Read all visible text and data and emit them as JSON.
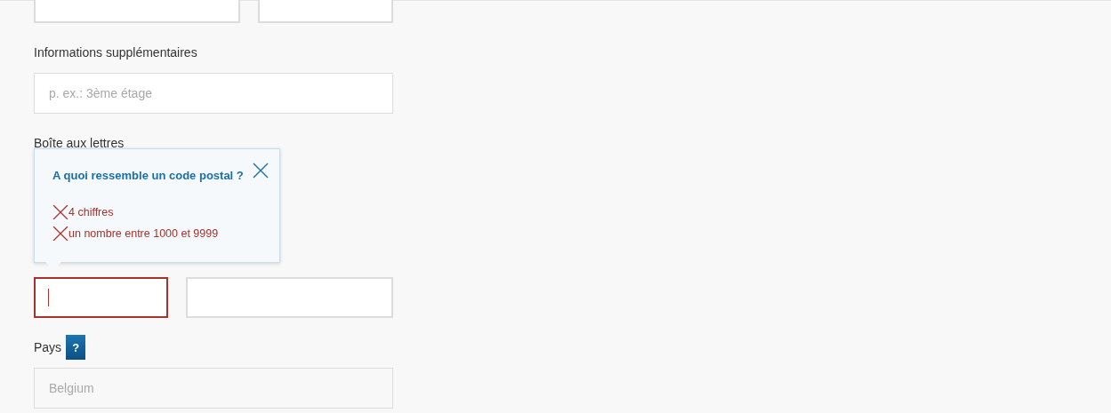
{
  "top_fields": [
    {
      "error": false,
      "focused": false
    },
    {
      "error": false,
      "focused": false
    }
  ],
  "extra_info": {
    "label": "Informations supplémentaires",
    "placeholder": "p. ex.: 3ème étage"
  },
  "mailbox": {
    "label": "Boîte aux lettres"
  },
  "tooltip": {
    "title": "A quoi ressemble un code postal ?",
    "rules": [
      {
        "text": "4 chiffres",
        "valid": false
      },
      {
        "text": "un nombre entre 1000 et 9999",
        "valid": false
      }
    ]
  },
  "postal_fields": [
    {
      "error": true,
      "focused": true
    },
    {
      "error": false,
      "focused": false
    }
  ],
  "country": {
    "label": "Pays",
    "help": "?",
    "value": "Belgium",
    "disabled": true
  }
}
